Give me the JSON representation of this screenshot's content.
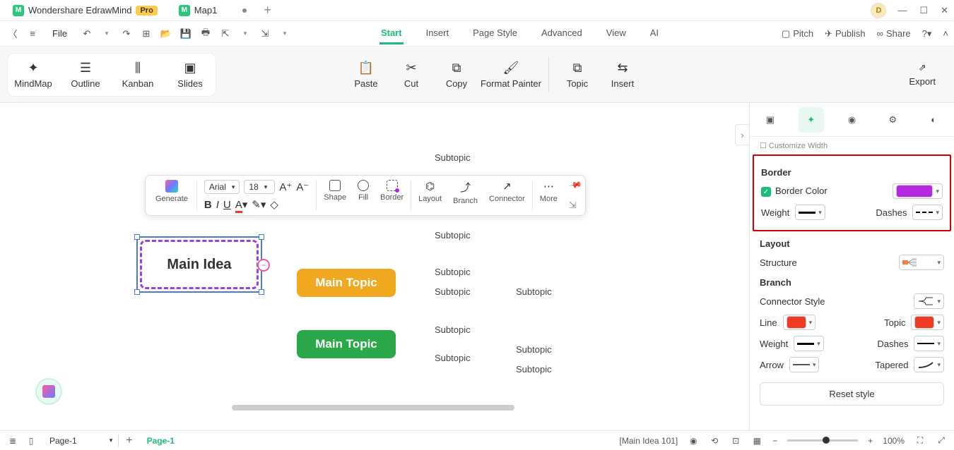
{
  "titlebar": {
    "app_name": "Wondershare EdrawMind",
    "pro_label": "Pro",
    "doc_tab": "Map1",
    "avatar_letter": "D"
  },
  "menubar": {
    "file_label": "File",
    "tabs": {
      "start": "Start",
      "insert": "Insert",
      "page_style": "Page Style",
      "advanced": "Advanced",
      "view": "View",
      "ai": "AI"
    },
    "right": {
      "pitch": "Pitch",
      "publish": "Publish",
      "share": "Share"
    }
  },
  "ribbon": {
    "views": {
      "mindmap": "MindMap",
      "outline": "Outline",
      "kanban": "Kanban",
      "slides": "Slides"
    },
    "clipboard": {
      "paste": "Paste",
      "cut": "Cut",
      "copy": "Copy",
      "painter": "Format Painter"
    },
    "insert": {
      "topic": "Topic",
      "insert": "Insert"
    },
    "export": "Export"
  },
  "float_toolbar": {
    "generate": "Generate",
    "font_name": "Arial",
    "font_size": "18",
    "shape": "Shape",
    "fill": "Fill",
    "border": "Border",
    "layout": "Layout",
    "branch": "Branch",
    "connector": "Connector",
    "more": "More"
  },
  "mindmap": {
    "main_idea": "Main Idea",
    "main_topic": "Main Topic",
    "subtopic": "Subtopic"
  },
  "right_panel": {
    "truncated_item": "Customize Width",
    "border_title": "Border",
    "border_color_label": "Border Color",
    "border_color": "#b528e0",
    "weight_label": "Weight",
    "dashes_label": "Dashes",
    "layout_title": "Layout",
    "structure_label": "Structure",
    "branch_title": "Branch",
    "connector_style": "Connector Style",
    "line_label": "Line",
    "line_color": "#ef3b24",
    "topic_label": "Topic",
    "topic_color": "#ef3b24",
    "arrow_label": "Arrow",
    "tapered_label": "Tapered",
    "reset_label": "Reset style"
  },
  "statusbar": {
    "page_dd": "Page-1",
    "page_tab": "Page-1",
    "selection_info": "[Main Idea 101]",
    "zoom_value": "100%"
  }
}
